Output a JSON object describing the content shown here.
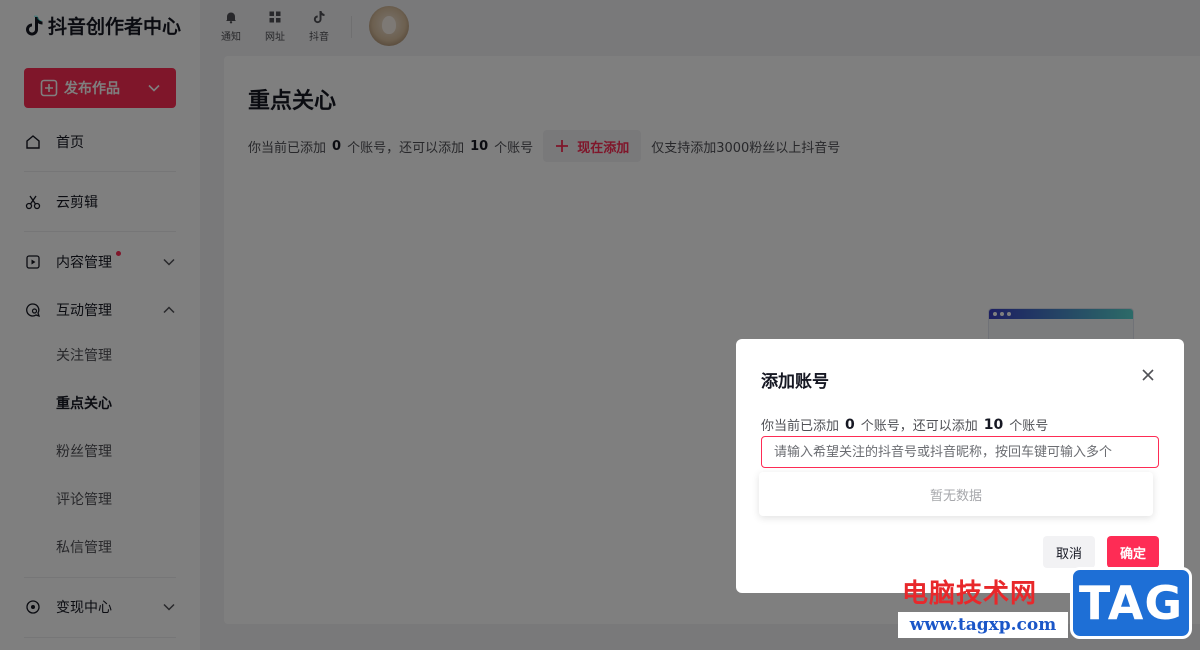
{
  "app": {
    "logo_text": "抖音创作者中心",
    "publish_label": "发布作品"
  },
  "topbar": {
    "items": [
      {
        "label": "通知",
        "icon": "bell-icon"
      },
      {
        "label": "网址",
        "icon": "grid-icon"
      },
      {
        "label": "抖音",
        "icon": "tiktok-icon"
      }
    ]
  },
  "sidebar": {
    "home": "首页",
    "cloud_edit": "云剪辑",
    "content_mgmt": "内容管理",
    "interaction_mgmt": "互动管理",
    "sub_items": [
      "关注管理",
      "重点关心",
      "粉丝管理",
      "评论管理",
      "私信管理"
    ],
    "monetize": "变现中心"
  },
  "main": {
    "title": "重点关心",
    "info_prefix": "你当前已添加",
    "added_count": "0",
    "info_mid": "个账号，还可以添加",
    "remaining_count": "10",
    "info_suffix": "个账号",
    "add_now_label": "现在添加",
    "note": "仅支持添加3000粉丝以上抖音号"
  },
  "modal": {
    "title": "添加账号",
    "info_prefix": "你当前已添加",
    "added_count": "0",
    "info_mid": "个账号，还可以添加",
    "remaining_count": "10",
    "info_suffix": "个账号",
    "input_placeholder": "请输入希望关注的抖音号或抖音昵称，按回车键可输入多个",
    "empty_text": "暂无数据",
    "cancel_label": "取消",
    "ok_label": "确定"
  },
  "watermark": {
    "site_name": "电脑技术网",
    "url": "www.tagxp.com",
    "tag": "TAG"
  },
  "colors": {
    "accent": "#fe2c55",
    "text_primary": "#161823",
    "text_secondary": "#505156"
  }
}
